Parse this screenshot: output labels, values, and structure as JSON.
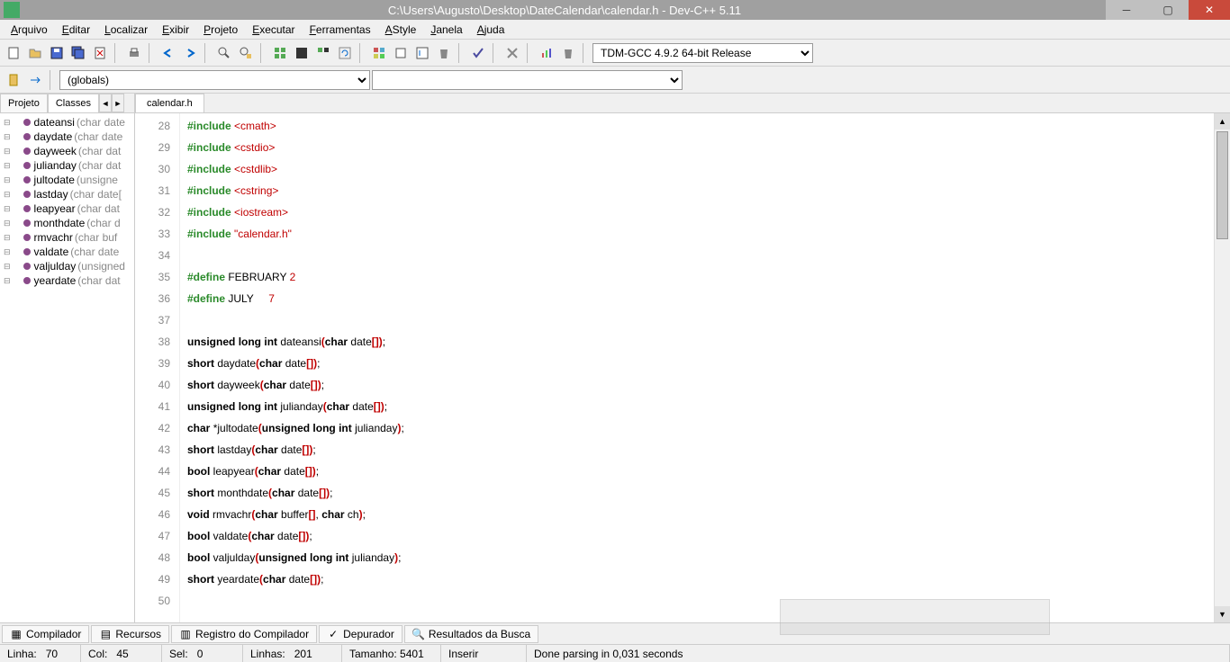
{
  "window": {
    "title": "C:\\Users\\Augusto\\Desktop\\DateCalendar\\calendar.h - Dev-C++ 5.11"
  },
  "menu": [
    "Arquivo",
    "Editar",
    "Localizar",
    "Exibir",
    "Projeto",
    "Executar",
    "Ferramentas",
    "AStyle",
    "Janela",
    "Ajuda"
  ],
  "compiler_combo": "TDM-GCC 4.9.2 64-bit Release",
  "scope_combo": "(globals)",
  "side_tabs": {
    "project": "Projeto",
    "classes": "Classes"
  },
  "tree": [
    {
      "name": "dateansi",
      "sig": "(char date"
    },
    {
      "name": "daydate",
      "sig": "(char date"
    },
    {
      "name": "dayweek",
      "sig": "(char dat"
    },
    {
      "name": "julianday",
      "sig": "(char dat"
    },
    {
      "name": "jultodate",
      "sig": "(unsigne"
    },
    {
      "name": "lastday",
      "sig": "(char date["
    },
    {
      "name": "leapyear",
      "sig": "(char dat"
    },
    {
      "name": "monthdate",
      "sig": "(char d"
    },
    {
      "name": "rmvachr",
      "sig": "(char buf"
    },
    {
      "name": "valdate",
      "sig": "(char date"
    },
    {
      "name": "valjulday",
      "sig": "(unsigned"
    },
    {
      "name": "yeardate",
      "sig": "(char dat"
    }
  ],
  "editor_tab": "calendar.h",
  "lines": [
    {
      "n": 28,
      "t": "include",
      "h": "<cmath>"
    },
    {
      "n": 29,
      "t": "include",
      "h": "<cstdio>"
    },
    {
      "n": 30,
      "t": "include",
      "h": "<cstdlib>"
    },
    {
      "n": 31,
      "t": "include",
      "h": "<cstring>"
    },
    {
      "n": 32,
      "t": "include",
      "h": "<iostream>"
    },
    {
      "n": 33,
      "t": "include",
      "h": "\"calendar.h\""
    },
    {
      "n": 34,
      "t": "blank"
    },
    {
      "n": 35,
      "t": "define",
      "m": "FEBRUARY",
      "v": "2"
    },
    {
      "n": 36,
      "t": "define",
      "m": "JULY    ",
      "v": "7"
    },
    {
      "n": 37,
      "t": "blank"
    },
    {
      "n": 38,
      "t": "decl",
      "ret": "unsigned long int",
      "fn": "dateansi",
      "args": "char date[]"
    },
    {
      "n": 39,
      "t": "decl",
      "ret": "short",
      "fn": "daydate",
      "args": "char date[]"
    },
    {
      "n": 40,
      "t": "decl",
      "ret": "short",
      "fn": "dayweek",
      "args": "char date[]"
    },
    {
      "n": 41,
      "t": "decl",
      "ret": "unsigned long int",
      "fn": "julianday",
      "args": "char date[]"
    },
    {
      "n": 42,
      "t": "decl",
      "ret": "char *",
      "fn": "jultodate",
      "args": "unsigned long int julianday"
    },
    {
      "n": 43,
      "t": "decl",
      "ret": "short",
      "fn": "lastday",
      "args": "char date[]"
    },
    {
      "n": 44,
      "t": "decl",
      "ret": "bool",
      "fn": "leapyear",
      "args": "char date[]"
    },
    {
      "n": 45,
      "t": "decl",
      "ret": "short",
      "fn": "monthdate",
      "args": "char date[]"
    },
    {
      "n": 46,
      "t": "decl",
      "ret": "void",
      "fn": "rmvachr",
      "args": "char buffer[], char ch"
    },
    {
      "n": 47,
      "t": "decl",
      "ret": "bool",
      "fn": "valdate",
      "args": "char date[]"
    },
    {
      "n": 48,
      "t": "decl",
      "ret": "bool",
      "fn": "valjulday",
      "args": "unsigned long int julianday"
    },
    {
      "n": 49,
      "t": "decl",
      "ret": "short",
      "fn": "yeardate",
      "args": "char date[]"
    },
    {
      "n": 50,
      "t": "blank"
    }
  ],
  "bottom_tabs": [
    "Compilador",
    "Recursos",
    "Registro do Compilador",
    "Depurador",
    "Resultados da Busca"
  ],
  "status": {
    "linha_lbl": "Linha:",
    "linha": "70",
    "col_lbl": "Col:",
    "col": "45",
    "sel_lbl": "Sel:",
    "sel": "0",
    "linhas_lbl": "Linhas:",
    "linhas": "201",
    "tam_lbl": "Tamanho:",
    "tam": "5401",
    "mode": "Inserir",
    "msg": "Done parsing in 0,031 seconds"
  }
}
